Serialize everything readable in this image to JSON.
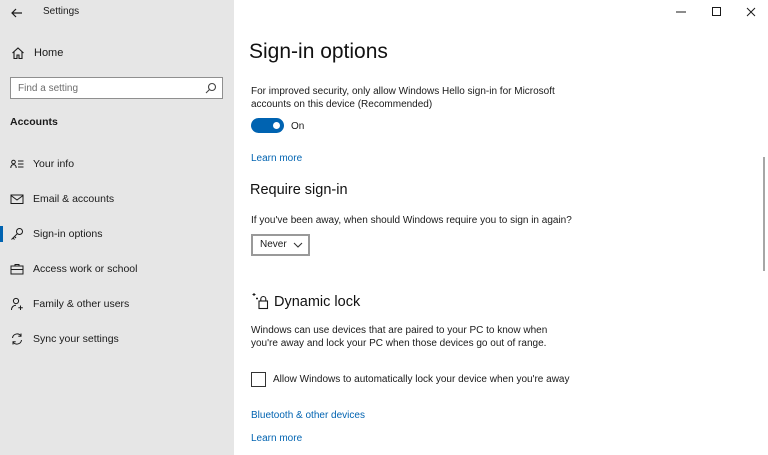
{
  "window": {
    "app_title": "Settings",
    "controls": {
      "minimize": "minimize",
      "maximize": "maximize",
      "close": "close"
    }
  },
  "sidebar": {
    "home_label": "Home",
    "search_placeholder": "Find a setting",
    "section_header": "Accounts",
    "items": [
      {
        "label": "Your info",
        "icon": "person-card-icon",
        "active": false
      },
      {
        "label": "Email & accounts",
        "icon": "mail-icon",
        "active": false
      },
      {
        "label": "Sign-in options",
        "icon": "key-icon",
        "active": true
      },
      {
        "label": "Access work or school",
        "icon": "briefcase-icon",
        "active": false
      },
      {
        "label": "Family & other users",
        "icon": "person-add-icon",
        "active": false
      },
      {
        "label": "Sync your settings",
        "icon": "sync-icon",
        "active": false
      }
    ]
  },
  "main": {
    "title": "Sign-in options",
    "hello_text_line1": "For improved security, only allow Windows Hello sign-in for Microsoft",
    "hello_text_line2": "accounts on this device (Recommended)",
    "toggle_state_label": "On",
    "toggle_on": true,
    "learn_more_1": "Learn more",
    "require_heading": "Require sign-in",
    "require_text": "If you've been away, when should Windows require you to sign in again?",
    "require_value": "Never",
    "dynamic_heading": "Dynamic lock",
    "dynamic_text_line1": "Windows can use devices that are paired to your PC to know when",
    "dynamic_text_line2": "you're away and lock your PC when those devices go out of range.",
    "dynamic_checkbox_label": "Allow Windows to automatically lock your device when you're away",
    "dynamic_checkbox_checked": false,
    "bluetooth_link": "Bluetooth & other devices",
    "learn_more_2": "Learn more"
  },
  "colors": {
    "accent": "#0063b1",
    "sidebar_bg": "#e6e6e6",
    "content_bg": "#ffffff"
  }
}
